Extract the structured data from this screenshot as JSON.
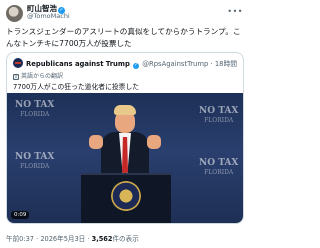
{
  "author": {
    "name": "町山智浩",
    "handle": "@TomoMachi",
    "more_icon": "more-horizontal-icon"
  },
  "post": {
    "text": "トランスジェンダーのアスリートの真似をしてからかうトランプ。こんなトンチキに7700万人が投票した"
  },
  "quote": {
    "name": "Republicans against Trump",
    "handle": "@RpsAgainstTrump",
    "separator": "·",
    "time": "18時間",
    "translated_label": "英語からの翻訳",
    "text": "7700万人がこの狂った道化者に投票した",
    "video": {
      "duration": "0:09",
      "backdrop_text": "NO TAX",
      "backdrop_subtext": "FLORIDA"
    }
  },
  "meta": {
    "time": "午前0:37",
    "separator": "·",
    "date": "2026年5月3日",
    "views_count": "3,562",
    "views_label": "件の表示"
  },
  "colors": {
    "verified": "#1d9bf0",
    "secondary_text": "#536471",
    "border": "#cfd9de"
  }
}
